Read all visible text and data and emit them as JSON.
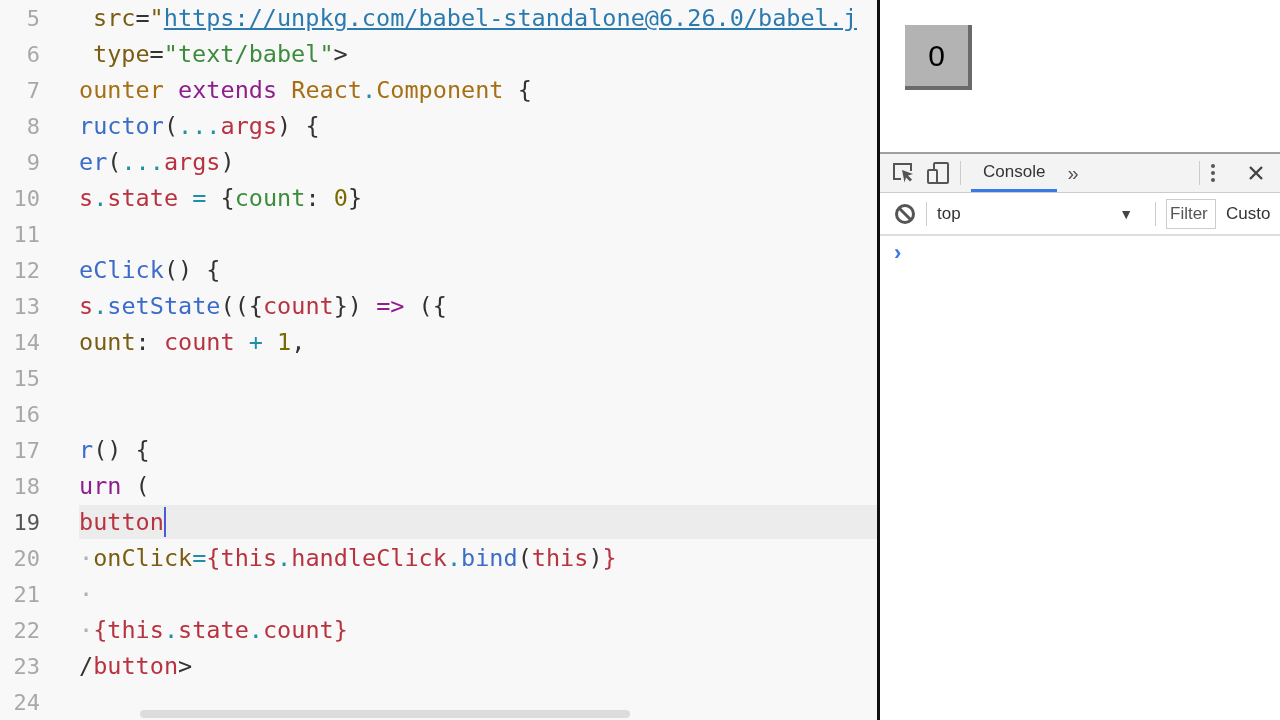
{
  "editor": {
    "lines": [
      {
        "number": "5",
        "current": false,
        "indented": true,
        "tokens": [
          {
            "kind": "attr",
            "text": "src"
          },
          {
            "kind": "plain",
            "text": "="
          },
          {
            "kind": "attr",
            "text": "\""
          },
          {
            "kind": "link",
            "text": "https://unpkg.com/babel-standalone@6.26.0/babel.j"
          }
        ]
      },
      {
        "number": "6",
        "current": false,
        "indented": true,
        "tokens": [
          {
            "kind": "attr",
            "text": "type"
          },
          {
            "kind": "plain",
            "text": "="
          },
          {
            "kind": "string",
            "text": "\"text/babel\""
          },
          {
            "kind": "plain",
            "text": ">"
          }
        ]
      },
      {
        "number": "7",
        "current": false,
        "indented": false,
        "tokens": [
          {
            "kind": "class",
            "text": "ounter"
          },
          {
            "kind": "keyword",
            "text": " extends "
          },
          {
            "kind": "class",
            "text": "React"
          },
          {
            "kind": "punct",
            "text": "."
          },
          {
            "kind": "class",
            "text": "Component"
          },
          {
            "kind": "plain",
            "text": " {"
          }
        ]
      },
      {
        "number": "8",
        "current": false,
        "indented": false,
        "tokens": [
          {
            "kind": "fn",
            "text": "ructor"
          },
          {
            "kind": "plain",
            "text": "("
          },
          {
            "kind": "punct",
            "text": "..."
          },
          {
            "kind": "var",
            "text": "args"
          },
          {
            "kind": "plain",
            "text": ") {"
          }
        ]
      },
      {
        "number": "9",
        "current": false,
        "indented": false,
        "tokens": [
          {
            "kind": "fn",
            "text": "er"
          },
          {
            "kind": "plain",
            "text": "("
          },
          {
            "kind": "punct",
            "text": "..."
          },
          {
            "kind": "var",
            "text": "args"
          },
          {
            "kind": "plain",
            "text": ")"
          }
        ]
      },
      {
        "number": "10",
        "current": false,
        "indented": false,
        "tokens": [
          {
            "kind": "var",
            "text": "s"
          },
          {
            "kind": "punct",
            "text": "."
          },
          {
            "kind": "var",
            "text": "state"
          },
          {
            "kind": "punct",
            "text": " = "
          },
          {
            "kind": "plain",
            "text": "{"
          },
          {
            "kind": "string",
            "text": "count"
          },
          {
            "kind": "plain",
            "text": ": "
          },
          {
            "kind": "number",
            "text": "0"
          },
          {
            "kind": "plain",
            "text": "}"
          }
        ]
      },
      {
        "number": "11",
        "current": false
      },
      {
        "number": "12",
        "current": false,
        "indented": false,
        "tokens": [
          {
            "kind": "fn",
            "text": "eClick"
          },
          {
            "kind": "plain",
            "text": "() {"
          }
        ]
      },
      {
        "number": "13",
        "current": false,
        "indented": false,
        "tokens": [
          {
            "kind": "var",
            "text": "s"
          },
          {
            "kind": "punct",
            "text": "."
          },
          {
            "kind": "fn",
            "text": "setState"
          },
          {
            "kind": "plain",
            "text": "(({"
          },
          {
            "kind": "var",
            "text": "count"
          },
          {
            "kind": "plain",
            "text": "})"
          },
          {
            "kind": "keyword",
            "text": " => "
          },
          {
            "kind": "plain",
            "text": "({"
          }
        ]
      },
      {
        "number": "14",
        "current": false,
        "indented": false,
        "tokens": [
          {
            "kind": "attr",
            "text": "ount"
          },
          {
            "kind": "plain",
            "text": ": "
          },
          {
            "kind": "var",
            "text": "count"
          },
          {
            "kind": "punct",
            "text": " + "
          },
          {
            "kind": "number",
            "text": "1"
          },
          {
            "kind": "plain",
            "text": ","
          }
        ]
      },
      {
        "number": "15",
        "current": false
      },
      {
        "number": "16",
        "current": false
      },
      {
        "number": "17",
        "current": false,
        "indented": false,
        "tokens": [
          {
            "kind": "fn",
            "text": "r"
          },
          {
            "kind": "plain",
            "text": "() {"
          }
        ]
      },
      {
        "number": "18",
        "current": false,
        "indented": false,
        "tokens": [
          {
            "kind": "keyword",
            "text": "urn"
          },
          {
            "kind": "plain",
            "text": " ("
          }
        ]
      },
      {
        "number": "19",
        "current": true,
        "indented": false,
        "tokens": [
          {
            "kind": "var",
            "text": "button"
          }
        ]
      },
      {
        "number": "20",
        "current": false,
        "indented": false,
        "tokens": [
          {
            "kind": "ws",
            "text": "·"
          },
          {
            "kind": "attr",
            "text": "onClick"
          },
          {
            "kind": "punct",
            "text": "="
          },
          {
            "kind": "var",
            "text": "{this"
          },
          {
            "kind": "punct",
            "text": "."
          },
          {
            "kind": "var",
            "text": "handleClick"
          },
          {
            "kind": "punct",
            "text": "."
          },
          {
            "kind": "fn",
            "text": "bind"
          },
          {
            "kind": "plain",
            "text": "("
          },
          {
            "kind": "var",
            "text": "this"
          },
          {
            "kind": "plain",
            "text": ")"
          },
          {
            "kind": "var",
            "text": "}"
          }
        ]
      },
      {
        "number": "21",
        "current": false,
        "indented": false,
        "tokens": [
          {
            "kind": "ws",
            "text": "·"
          }
        ]
      },
      {
        "number": "22",
        "current": false,
        "indented": false,
        "tokens": [
          {
            "kind": "ws",
            "text": "·"
          },
          {
            "kind": "var",
            "text": "{this"
          },
          {
            "kind": "punct",
            "text": "."
          },
          {
            "kind": "var",
            "text": "state"
          },
          {
            "kind": "punct",
            "text": "."
          },
          {
            "kind": "var",
            "text": "count}"
          }
        ]
      },
      {
        "number": "23",
        "current": false,
        "indented": false,
        "tokens": [
          {
            "kind": "plain",
            "text": "/"
          },
          {
            "kind": "var",
            "text": "button"
          },
          {
            "kind": "plain",
            "text": ">"
          }
        ]
      },
      {
        "number": "24",
        "current": false
      }
    ]
  },
  "preview": {
    "button": "0"
  },
  "devtools": {
    "tabs": [
      {
        "label": "Console",
        "selected": true
      }
    ],
    "more": "»",
    "context": "top",
    "context_caret": "▼",
    "filter": {
      "placeholder": "Filter"
    },
    "levels_label": "Custo",
    "prompt": "›"
  }
}
